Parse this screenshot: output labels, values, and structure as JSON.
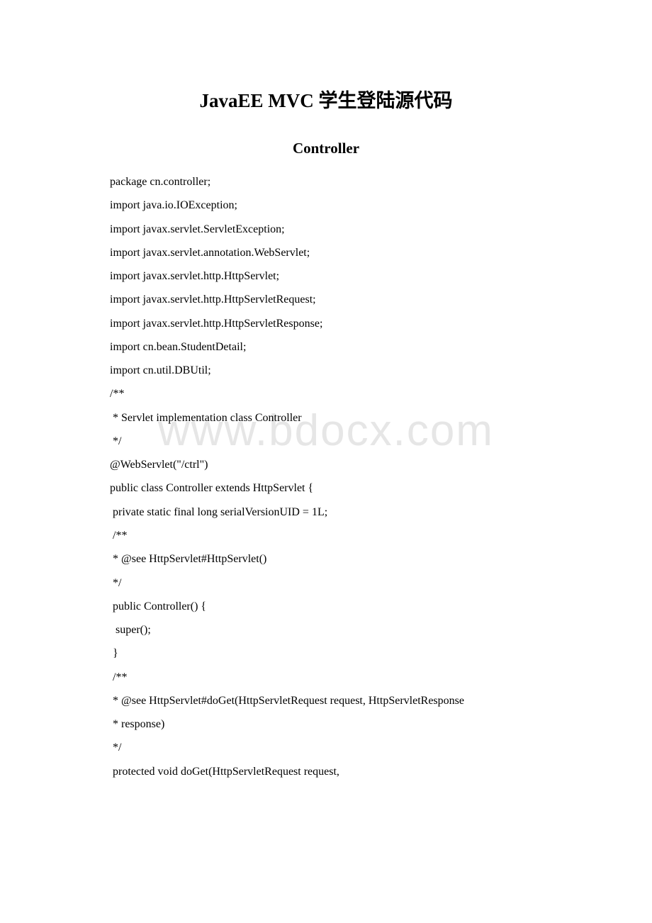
{
  "title": "JavaEE MVC 学生登陆源代码",
  "subtitle": "Controller",
  "watermark": "www.bdocx.com",
  "lines": [
    "package cn.controller;",
    "import java.io.IOException;",
    "import javax.servlet.ServletException;",
    "import javax.servlet.annotation.WebServlet;",
    "import javax.servlet.http.HttpServlet;",
    "import javax.servlet.http.HttpServletRequest;",
    "import javax.servlet.http.HttpServletResponse;",
    "import cn.bean.StudentDetail;",
    "import cn.util.DBUtil;",
    "/**",
    " * Servlet implementation class Controller",
    " */",
    "@WebServlet(\"/ctrl\")",
    "public class Controller extends HttpServlet {",
    " private static final long serialVersionUID = 1L;",
    " /**",
    " * @see HttpServlet#HttpServlet()",
    " */",
    " public Controller() {",
    "  super();",
    " }",
    " /**",
    " * @see HttpServlet#doGet(HttpServletRequest request, HttpServletResponse",
    " * response)",
    " */",
    " protected void doGet(HttpServletRequest request,"
  ]
}
